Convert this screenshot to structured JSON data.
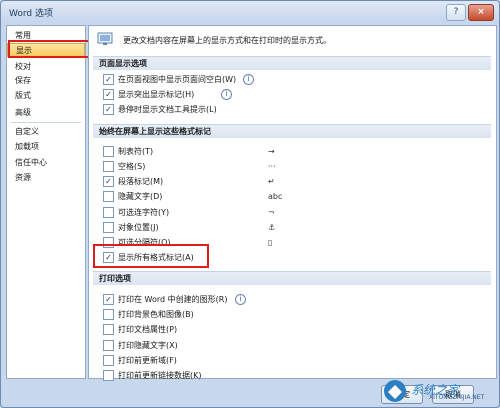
{
  "window": {
    "title": "Word 选项",
    "help_icon": "?",
    "close_icon": "×"
  },
  "sidebar": {
    "items": [
      {
        "label": "常用"
      },
      {
        "label": "显示"
      },
      {
        "label": "校对"
      },
      {
        "label": "保存"
      },
      {
        "label": "版式"
      },
      {
        "label": "高级"
      },
      {
        "label": "自定义"
      },
      {
        "label": "加载项"
      },
      {
        "label": "信任中心"
      },
      {
        "label": "资源"
      }
    ]
  },
  "content": {
    "intro": "更改文档内容在屏幕上的显示方式和在打印时的显示方式。",
    "section1": {
      "title": "页面显示选项",
      "items": [
        {
          "label": "在页面视图中显示页面间空白(W)",
          "checked": true,
          "info": "i"
        },
        {
          "label": "显示突出显示标记(H)",
          "checked": true,
          "info": "i"
        },
        {
          "label": "悬停时显示文档工具提示(L)",
          "checked": true
        }
      ]
    },
    "section2": {
      "title": "始终在屏幕上显示这些格式标记",
      "items": [
        {
          "label": "制表符(T)",
          "checked": false,
          "symbol": "→"
        },
        {
          "label": "空格(S)",
          "checked": false,
          "symbol": "···"
        },
        {
          "label": "段落标记(M)",
          "checked": true,
          "symbol": "↵"
        },
        {
          "label": "隐藏文字(D)",
          "checked": false,
          "symbol": "abc"
        },
        {
          "label": "可选连字符(Y)",
          "checked": false,
          "symbol": "¬"
        },
        {
          "label": "对象位置(J)",
          "checked": false,
          "symbol": "⚓"
        },
        {
          "label": "可选分隔符(O)",
          "checked": false,
          "symbol": "▯"
        },
        {
          "label": "显示所有格式标记(A)",
          "checked": true
        }
      ]
    },
    "section3": {
      "title": "打印选项",
      "items": [
        {
          "label": "打印在 Word 中创建的图形(R)",
          "checked": true,
          "info": "i"
        },
        {
          "label": "打印背景色和图像(B)",
          "checked": false
        },
        {
          "label": "打印文档属性(P)",
          "checked": false
        },
        {
          "label": "打印隐藏文字(X)",
          "checked": false
        },
        {
          "label": "打印前更新域(F)",
          "checked": false
        },
        {
          "label": "打印前更新链接数据(K)",
          "checked": false
        }
      ]
    }
  },
  "footer": {
    "ok": "确定",
    "cancel": "取消"
  },
  "watermark": {
    "title": "系统之家",
    "url": "XITONGZHIJIA.NET"
  },
  "colors": {
    "highlight": "#e01d1d",
    "selected_bg": "#f9cb5f",
    "section_bg": "#dbe5f1"
  }
}
